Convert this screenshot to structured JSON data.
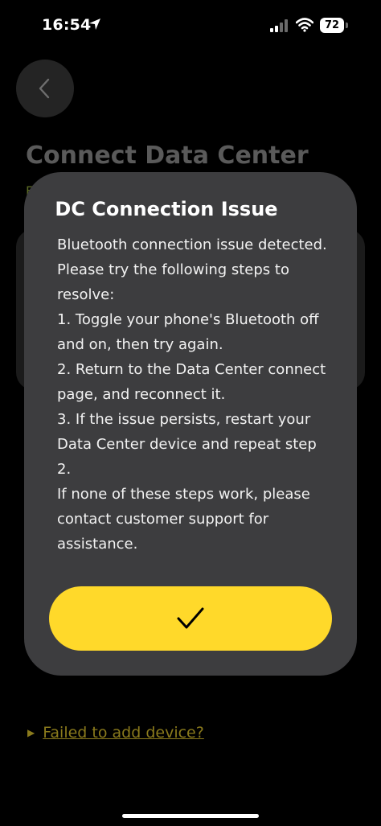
{
  "status_bar": {
    "time": "16:54",
    "battery": "72"
  },
  "page": {
    "title": "Connect Data Center",
    "subtitle_snippet": "Fi",
    "failed_link": "Failed to add device?"
  },
  "dialog": {
    "title": "DC Connection Issue",
    "lines": [
      "Bluetooth connection issue detected. Please try the following steps to resolve:",
      "1. Toggle your phone's Bluetooth off and on, then try again.",
      "2. Return to the Data Center connect page, and reconnect it.",
      "3. If the issue persists, restart your Data Center device and repeat step 2.",
      "If none of these steps work, please contact customer support for assistance."
    ],
    "confirm_icon": "checkmark-icon"
  },
  "colors": {
    "accent_yellow": "#ffd92a",
    "dialog_bg": "#3d3d3f",
    "background": "#000000"
  }
}
